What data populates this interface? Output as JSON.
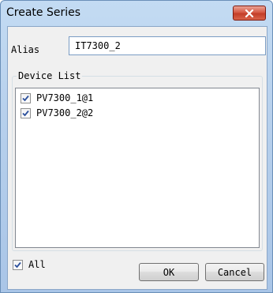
{
  "window": {
    "title": "Create Series",
    "close_icon": "close-icon"
  },
  "alias": {
    "label": "Alias",
    "value": "IT7300_2"
  },
  "device_list": {
    "label": "Device List",
    "items": [
      {
        "label": "PV7300_1@1",
        "checked": true
      },
      {
        "label": "PV7300_2@2",
        "checked": true
      }
    ]
  },
  "footer": {
    "all_label": "All",
    "all_checked": true,
    "ok_label": "OK",
    "cancel_label": "Cancel"
  },
  "colors": {
    "close_button": "#c33d28",
    "check_mark": "#2a4f9c",
    "title_bar": "#b7d0ec"
  }
}
